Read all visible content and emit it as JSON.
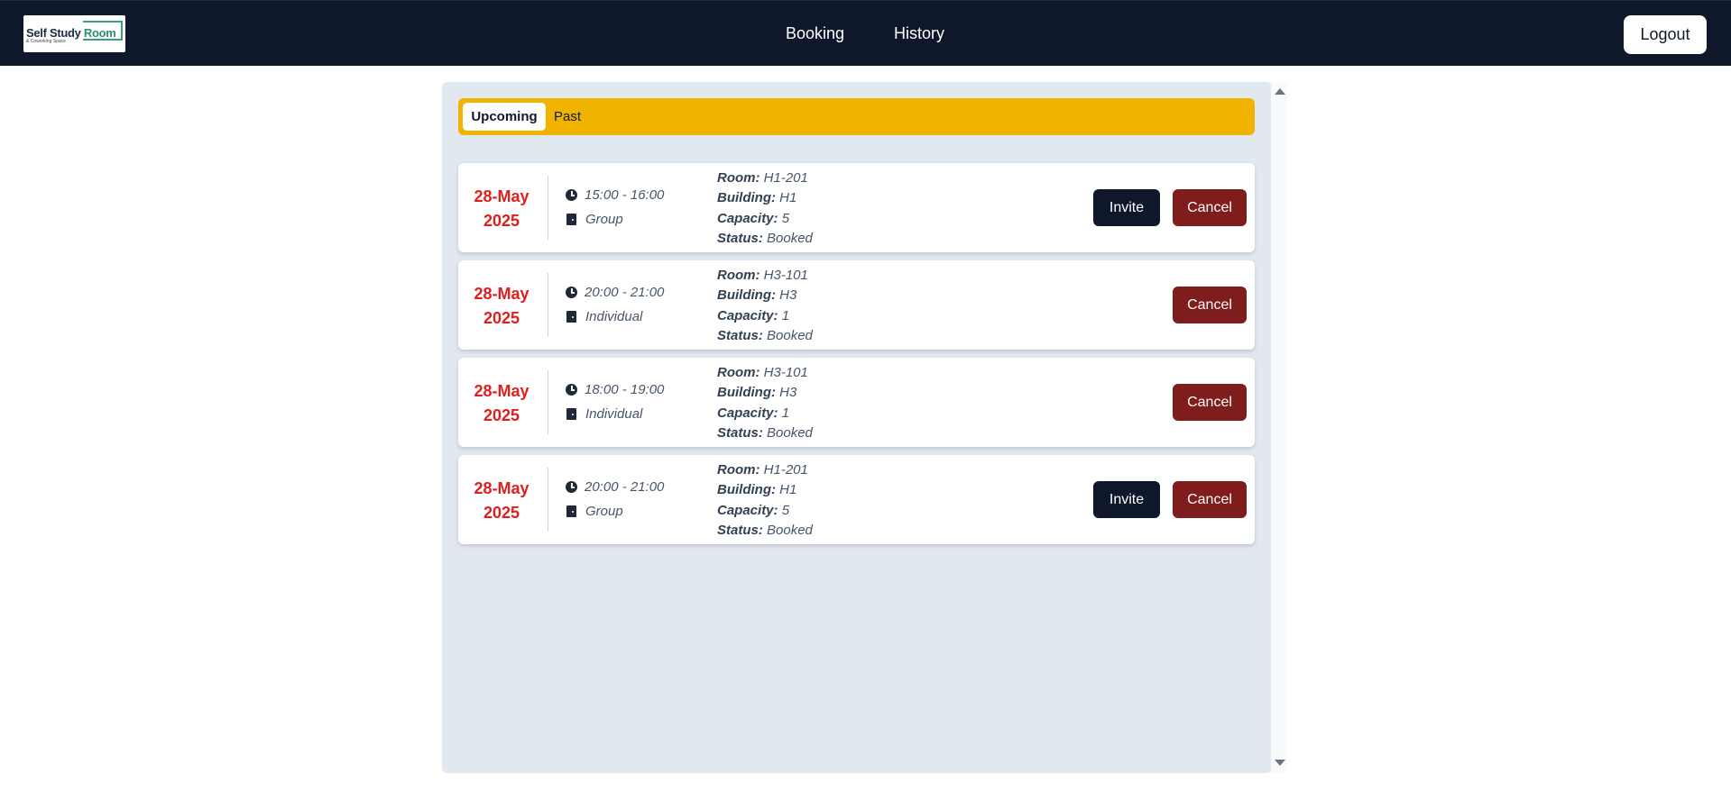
{
  "header": {
    "logo_text_1": "Self Study ",
    "logo_text_2": "Room",
    "logo_sub": "& Coworking Space",
    "nav": {
      "booking": "Booking",
      "history": "History"
    },
    "logout": "Logout"
  },
  "tabs": {
    "upcoming": "Upcoming",
    "past": "Past",
    "active": "Upcoming"
  },
  "labels": {
    "room": "Room:",
    "building": "Building:",
    "capacity": "Capacity:",
    "status": "Status:"
  },
  "buttons": {
    "invite": "Invite",
    "cancel": "Cancel"
  },
  "bookings": [
    {
      "day": "28-May",
      "year": "2025",
      "time": "15:00 - 16:00",
      "type": "Group",
      "room": "H1-201",
      "building": "H1",
      "capacity": "5",
      "status": "Booked"
    },
    {
      "day": "28-May",
      "year": "2025",
      "time": "20:00 - 21:00",
      "type": "Individual",
      "room": "H3-101",
      "building": "H3",
      "capacity": "1",
      "status": "Booked"
    },
    {
      "day": "28-May",
      "year": "2025",
      "time": "18:00 - 19:00",
      "type": "Individual",
      "room": "H3-101",
      "building": "H3",
      "capacity": "1",
      "status": "Booked"
    },
    {
      "day": "28-May",
      "year": "2025",
      "time": "20:00 - 21:00",
      "type": "Group",
      "room": "H1-201",
      "building": "H1",
      "capacity": "5",
      "status": "Booked"
    }
  ],
  "colors": {
    "navbar": "#0f172a",
    "tabbar": "#f0b400",
    "date": "#e11d1d",
    "cancel": "#7f1d1d",
    "invite": "#0f172a",
    "panel": "#e2e8f0"
  },
  "icons": {
    "time": "clock-icon",
    "room_type": "door-icon"
  }
}
